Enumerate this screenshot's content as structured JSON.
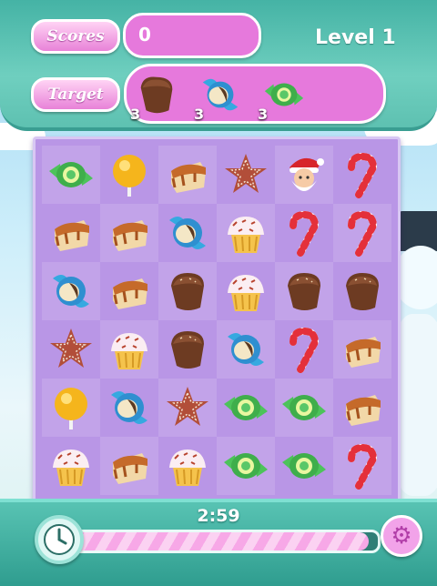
{
  "header": {
    "scores_label": "Scores",
    "score_value": "0",
    "level_text": "Level 1",
    "target_label": "Target",
    "targets": [
      {
        "icon": "chocolate-muffin-icon",
        "count": "3"
      },
      {
        "icon": "blue-wrapped-candy-icon",
        "count": "3"
      },
      {
        "icon": "green-wrapped-candy-icon",
        "count": "3"
      }
    ]
  },
  "board": {
    "rows": 6,
    "cols": 6,
    "grid": [
      [
        "green-wrapped-candy",
        "lollipop",
        "caramel-cake",
        "gingerbread-star",
        "santa",
        "candy-cane"
      ],
      [
        "caramel-cake",
        "caramel-cake",
        "blue-wrapped-candy",
        "cupcake",
        "candy-cane",
        "candy-cane"
      ],
      [
        "blue-wrapped-candy",
        "caramel-cake",
        "chocolate-muffin",
        "cupcake",
        "chocolate-muffin",
        "chocolate-muffin"
      ],
      [
        "gingerbread-star",
        "cupcake",
        "chocolate-muffin",
        "blue-wrapped-candy",
        "candy-cane",
        "caramel-cake"
      ],
      [
        "lollipop",
        "blue-wrapped-candy",
        "gingerbread-star",
        "green-wrapped-candy",
        "green-wrapped-candy",
        "caramel-cake"
      ],
      [
        "cupcake",
        "caramel-cake",
        "cupcake",
        "green-wrapped-candy",
        "green-wrapped-candy",
        "candy-cane"
      ]
    ]
  },
  "footer": {
    "timer": "2:59",
    "time_progress": 0.97,
    "clock_icon": "clock-icon",
    "settings_icon": "gear-icon"
  }
}
